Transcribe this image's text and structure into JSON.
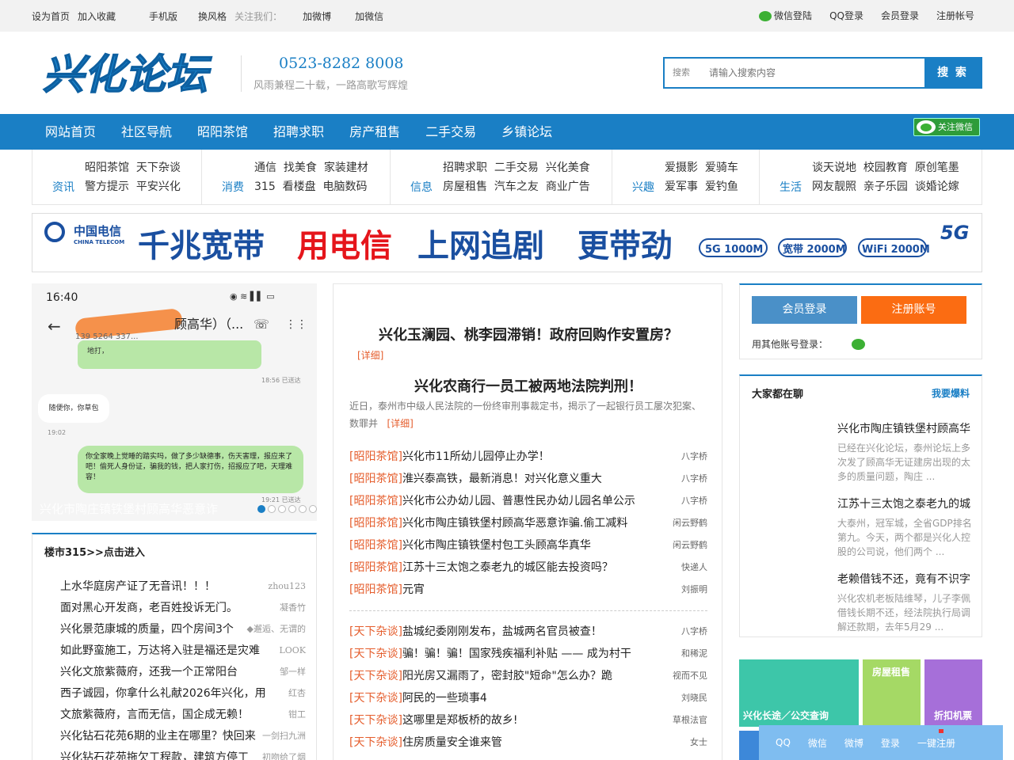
{
  "topbar": {
    "left": [
      "设为首页",
      "加入收藏",
      "手机版",
      "换风格",
      "关注我们：",
      "加微博",
      "加微信"
    ],
    "right": [
      "微信登陆",
      "QQ登录",
      "会员登录",
      "注册帐号"
    ]
  },
  "header": {
    "logo": "兴化论坛",
    "phone": "0523-8282 8008",
    "slogan": "风雨兼程二十载，一路高歌写辉煌",
    "search_label": "搜索",
    "search_placeholder": "请输入搜索内容",
    "search_button": "搜 索"
  },
  "nav": [
    "网站首页",
    "社区导航",
    "昭阳茶馆",
    "招聘求职",
    "房产租售",
    "二手交易",
    "乡镇论坛"
  ],
  "wx_follow": "关注微信",
  "cats": [
    {
      "title": "资讯",
      "row1": [
        "昭阳茶馆",
        "天下杂谈"
      ],
      "row2": [
        "警方提示",
        "平安兴化"
      ]
    },
    {
      "title": "消费",
      "row1": [
        "通信",
        "找美食",
        "家装建材"
      ],
      "row2": [
        "315",
        "看楼盘",
        "电脑数码"
      ]
    },
    {
      "title": "信息",
      "row1": [
        "招聘求职",
        "二手交易",
        "兴化美食"
      ],
      "row2": [
        "房屋租售",
        "汽车之友",
        "商业广告"
      ]
    },
    {
      "title": "兴趣",
      "row1": [
        "爱摄影",
        "爱骑车"
      ],
      "row2": [
        "爱军事",
        "爱钓鱼"
      ]
    },
    {
      "title": "生活",
      "row1": [
        "谈天说地",
        "校园教育",
        "原创笔墨"
      ],
      "row2": [
        "网友靓照",
        "亲子乐园",
        "谈婚论嫁"
      ]
    }
  ],
  "banner": {
    "brand": "中国电信",
    "brand_en": "CHINA TELECOM",
    "headline_a": "千兆宽带",
    "headline_b": "用电信",
    "headline_c": "上网追剧",
    "headline_d": "更带劲",
    "tags": [
      "5G 1000M",
      "宽带 2000M",
      "WiFi 2000M"
    ],
    "g": "5G"
  },
  "slide": {
    "time": "16:40",
    "contact": "顾高华）（...",
    "phone": "139 5264 337...",
    "msg_top": "地打，",
    "time1": "18:56 已送达",
    "reply": "随便你，你草包",
    "time2": "19:02",
    "msg_big": "你全家晚上觉睡的踏实吗，做了多少缺德事，伤天害理，报应来了吧！偷死人身份证，骗我的钱，把人家打伤，招报应了吧，天理难容！",
    "time3": "19:21 已送达",
    "caption": "兴化市陶庄镇铁堡村顾高华恶意诈"
  },
  "box315": {
    "title": "楼市315>>点击进入",
    "items": [
      [
        "上水华庭房产证了无音讯！！！",
        "zhou123"
      ],
      [
        "面对黑心开发商，老百姓投诉无门。",
        "凝香竹"
      ],
      [
        "兴化景范康城的质量，四个房间3个",
        "◆邂逅、无谓的"
      ],
      [
        "如此野蛮施工，万达将入驻是福还是灾难",
        "LOOK"
      ],
      [
        "兴化文旅紫薇府，还我一个正常阳台",
        "邹一样"
      ],
      [
        "西子诚园，你拿什么礼献2026年兴化，用",
        "红杏"
      ],
      [
        "文旅紫薇府，言而无信，国企成无赖！",
        "钳工"
      ],
      [
        "兴化钻石花苑6期的业主在哪里？快回来",
        "一剑扫九洲"
      ],
      [
        "兴化钻石花苑拖欠工程款，建筑方停工",
        "初吻给了烟"
      ]
    ]
  },
  "mid": {
    "h1": "兴化玉澜园、桃李园滞销！政府回购作安置房？",
    "detail": "[详细]",
    "h2": "兴化农商行一员工被两地法院判刑！",
    "sum": "近日，泰州市中级人民法院的一份终审刑事裁定书，揭示了一起银行员工屡次犯案、数罪并",
    "list1": [
      [
        "[昭阳茶馆]",
        "兴化市11所幼儿园停止办学！",
        "八字桥"
      ],
      [
        "[昭阳茶馆]",
        "淮兴泰高铁，最新消息！对兴化意义重大",
        "八字桥"
      ],
      [
        "[昭阳茶馆]",
        "兴化市公办幼儿园、普惠性民办幼儿园名单公示",
        "八字桥"
      ],
      [
        "[昭阳茶馆]",
        "兴化市陶庄镇铁堡村顾高华恶意诈骗.偷工减料",
        "闲云野鹤"
      ],
      [
        "[昭阳茶馆]",
        "兴化市陶庄镇铁堡村包工头顾高华真华",
        "闲云野鹤"
      ],
      [
        "[昭阳茶馆]",
        "江苏十三太饱之泰老九的城区能去投资吗？",
        "快递人"
      ],
      [
        "[昭阳茶馆]",
        "元宵",
        "刘振明"
      ]
    ],
    "list2": [
      [
        "[天下杂谈]",
        "盐城纪委刚刚发布，盐城两名官员被查！",
        "八字桥"
      ],
      [
        "[天下杂谈]",
        "骗！骗！骗！国家残疾福利补贴 —— 成为村干",
        "和稀泥"
      ],
      [
        "[天下杂谈]",
        "阳光房又漏雨了，密封胶\"短命\"怎么办？跪",
        "视而不见"
      ],
      [
        "[天下杂谈]",
        "阿民的一些琐事4",
        "刘晓民"
      ],
      [
        "[天下杂谈]",
        "这哪里是郑板桥的故乡!",
        "草根法官"
      ],
      [
        "[天下杂谈]",
        "住房质量安全谁来管",
        "女士"
      ]
    ]
  },
  "right": {
    "login": "会员登录",
    "register": "注册账号",
    "other": "用其他账号登录：",
    "chat_title": "大家都在聊",
    "chat_more": "我要爆料",
    "chat": [
      {
        "title": "兴化市陶庄镇铁堡村顾高华",
        "desc": "已经在兴化论坛，泰州论坛上多次发了顾高华无证建房出现的太多的质量问题，陶庄 ..."
      },
      {
        "title": "江苏十三太饱之泰老九的城",
        "desc": "大泰州，冠军城，全省GDP排名第九。今天，两个都是兴化人控股的公司说，他们两个 ..."
      },
      {
        "title": "老赖借钱不还，竟有不识字",
        "desc": "兴化农机老板陆维琴，儿子李佩借钱长期不还，经法院执行局调解还款期，去年5月29 ..."
      }
    ],
    "tiles": [
      "兴化长途／公交查询",
      "房屋租售",
      "折扣机票"
    ]
  },
  "floatbar": [
    "QQ",
    "微信",
    "微博",
    "登录",
    "一键注册"
  ]
}
